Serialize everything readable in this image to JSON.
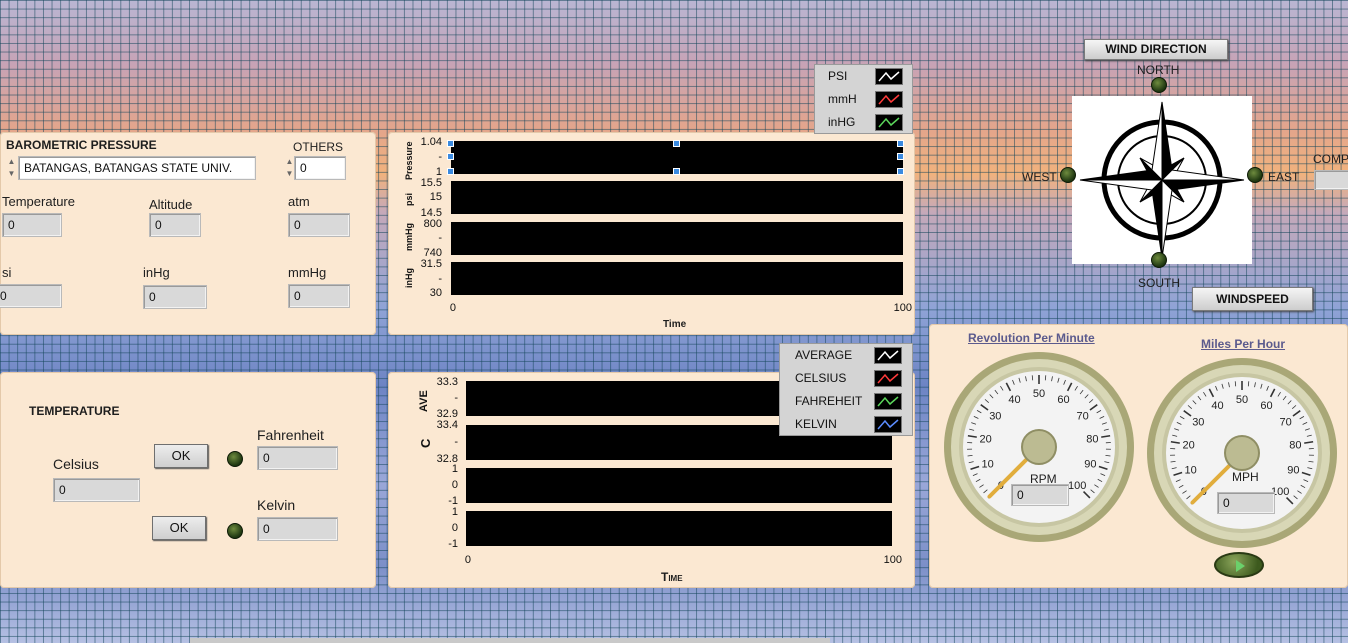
{
  "barometric": {
    "title": "BAROMETRIC PRESSURE",
    "location": "BATANGAS, BATANGAS STATE UNIV.",
    "others_label": "OTHERS",
    "others_value": "0",
    "fields": {
      "temperature_label": "Temperature",
      "temperature_value": "0",
      "altitude_label": "Altitude",
      "altitude_value": "0",
      "atm_label": "atm",
      "atm_value": "0",
      "psi_label": "si",
      "psi_value": "0",
      "inhg_label": "inHg",
      "inhg_value": "0",
      "mmhg_label": "mmHg",
      "mmhg_value": "0"
    }
  },
  "temperature": {
    "title": "TEMPERATURE",
    "celsius_label": "Celsius",
    "celsius_value": "0",
    "fahrenheit_label": "Fahrenheit",
    "fahrenheit_value": "0",
    "kelvin_label": "Kelvin",
    "kelvin_value": "0",
    "ok_label_1": "OK",
    "ok_label_2": "OK"
  },
  "pressure_chart": {
    "legend": [
      "PSI",
      "mmH",
      "inHG"
    ],
    "legend_colors": [
      "#ffffff",
      "#ff3b3b",
      "#5bd65b"
    ],
    "x_label": "Time",
    "x_min": "0",
    "x_max": "100",
    "plots": [
      {
        "label": "Pressure",
        "ticks": [
          "1.04",
          "-",
          "1"
        ]
      },
      {
        "label": "psi",
        "ticks": [
          "15.5",
          "15",
          "14.5"
        ]
      },
      {
        "label": "mmHg",
        "ticks": [
          "800",
          "-",
          "740"
        ]
      },
      {
        "label": "inHg",
        "ticks": [
          "31.5",
          "-",
          "30"
        ]
      }
    ]
  },
  "temp_chart": {
    "legend": [
      "AVERAGE",
      "CELSIUS",
      "FAHREHEIT",
      "KELVIN"
    ],
    "legend_colors": [
      "#ffffff",
      "#ff3b3b",
      "#5bd65b",
      "#5b8cff"
    ],
    "x_label": "Time",
    "x_min": "0",
    "x_max": "100",
    "plots": [
      {
        "label": "AVE",
        "ticks": [
          "33.3",
          "-",
          "32.9"
        ]
      },
      {
        "label": "C",
        "ticks": [
          "33.4",
          "-",
          "32.8"
        ]
      },
      {
        "label": "",
        "ticks": [
          "1",
          "0",
          "-1"
        ]
      },
      {
        "label": "",
        "ticks": [
          "1",
          "0",
          "-1"
        ]
      }
    ]
  },
  "wind": {
    "direction_button": "WIND DIRECTION",
    "north": "NORTH",
    "south": "SOUTH",
    "east": "EAST",
    "west": "WEST",
    "comp_label": "COMP",
    "speed_button": "WINDSPEED"
  },
  "gauges": {
    "rpm_title": "Revolution Per Minute",
    "mph_title": "Miles Per Hour",
    "rpm_unit": "RPM",
    "mph_unit": "MPH",
    "rpm_value": "0",
    "mph_value": "0",
    "rpm_level": 0,
    "mph_level": 0,
    "scale": [
      "0",
      "10",
      "20",
      "30",
      "40",
      "50",
      "60",
      "70",
      "80",
      "90",
      "100"
    ]
  }
}
